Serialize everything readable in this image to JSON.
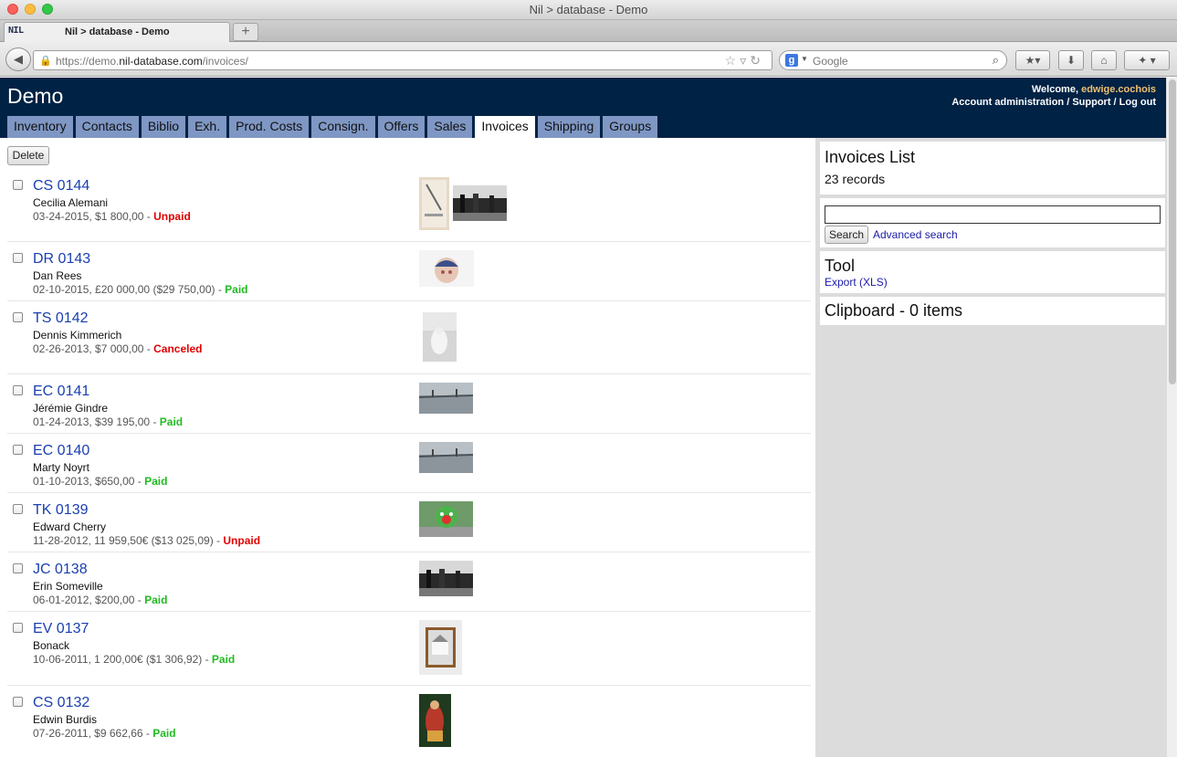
{
  "window": {
    "title": "Nil > database - Demo",
    "tab_title": "Nil > database - Demo",
    "favicon_text": "NIL",
    "new_tab_label": "+"
  },
  "navbar": {
    "url_prefix": "https://demo.",
    "url_domain": "nil-database.com",
    "url_path": "/invoices/",
    "search_placeholder": "Google"
  },
  "header": {
    "title": "Demo",
    "welcome_label": "Welcome,",
    "username": "edwige.cochois",
    "links": [
      "Account administration",
      "Support",
      "Log out"
    ]
  },
  "main_tabs": [
    {
      "label": "Inventory",
      "active": false
    },
    {
      "label": "Contacts",
      "active": false
    },
    {
      "label": "Biblio",
      "active": false
    },
    {
      "label": "Exh.",
      "active": false
    },
    {
      "label": "Prod. Costs",
      "active": false
    },
    {
      "label": "Consign.",
      "active": false
    },
    {
      "label": "Offers",
      "active": false
    },
    {
      "label": "Sales",
      "active": false
    },
    {
      "label": "Invoices",
      "active": true
    },
    {
      "label": "Shipping",
      "active": false
    },
    {
      "label": "Groups",
      "active": false
    }
  ],
  "toolbar": {
    "delete_label": "Delete"
  },
  "invoices": [
    {
      "id": "CS 0144",
      "client": "Cecilia Alemani",
      "details": "03-24-2015, $1 800,00 - ",
      "status": "Unpaid",
      "thumbs": [
        "sketch",
        "gallery-bw"
      ]
    },
    {
      "id": "DR 0143",
      "client": "Dan Rees",
      "details": "02-10-2015, £20 000,00 ($29 750,00) - ",
      "status": "Paid",
      "thumbs": [
        "sculpture-head"
      ]
    },
    {
      "id": "TS 0142",
      "client": "Dennis Kimmerich",
      "details": "02-26-2013, $7 000,00 - ",
      "status": "Canceled",
      "thumbs": [
        "misty-figure"
      ]
    },
    {
      "id": "EC 0141",
      "client": "Jérémie Gindre",
      "details": "01-24-2013, $39 195,00 - ",
      "status": "Paid",
      "thumbs": [
        "bridge"
      ]
    },
    {
      "id": "EC 0140",
      "client": "Marty Noyrt",
      "details": "01-10-2013, $650,00 - ",
      "status": "Paid",
      "thumbs": [
        "bridge"
      ]
    },
    {
      "id": "TK 0139",
      "client": "Edward Cherry",
      "details": "11-28-2012, 11 959,50€ ($13 025,09) - ",
      "status": "Unpaid",
      "thumbs": [
        "clown-sculpture"
      ]
    },
    {
      "id": "JC 0138",
      "client": "Erin Someville",
      "details": "06-01-2012, $200,00 - ",
      "status": "Paid",
      "thumbs": [
        "gallery-bw"
      ]
    },
    {
      "id": "EV 0137",
      "client": "Bonack",
      "details": "10-06-2011, 1 200,00€ ($1 306,92) - ",
      "status": "Paid",
      "thumbs": [
        "framed-house"
      ]
    },
    {
      "id": "CS 0132",
      "client": "Edwin Burdis",
      "details": "07-26-2011, $9 662,66 - ",
      "status": "Paid",
      "thumbs": [
        "saint-painting"
      ]
    }
  ],
  "sidebar": {
    "list_title": "Invoices List",
    "records": "23 records",
    "search_button": "Search",
    "advanced_search": "Advanced search",
    "tool_title": "Tool",
    "export_link": "Export (XLS)",
    "clipboard_title": "Clipboard - 0 items"
  }
}
